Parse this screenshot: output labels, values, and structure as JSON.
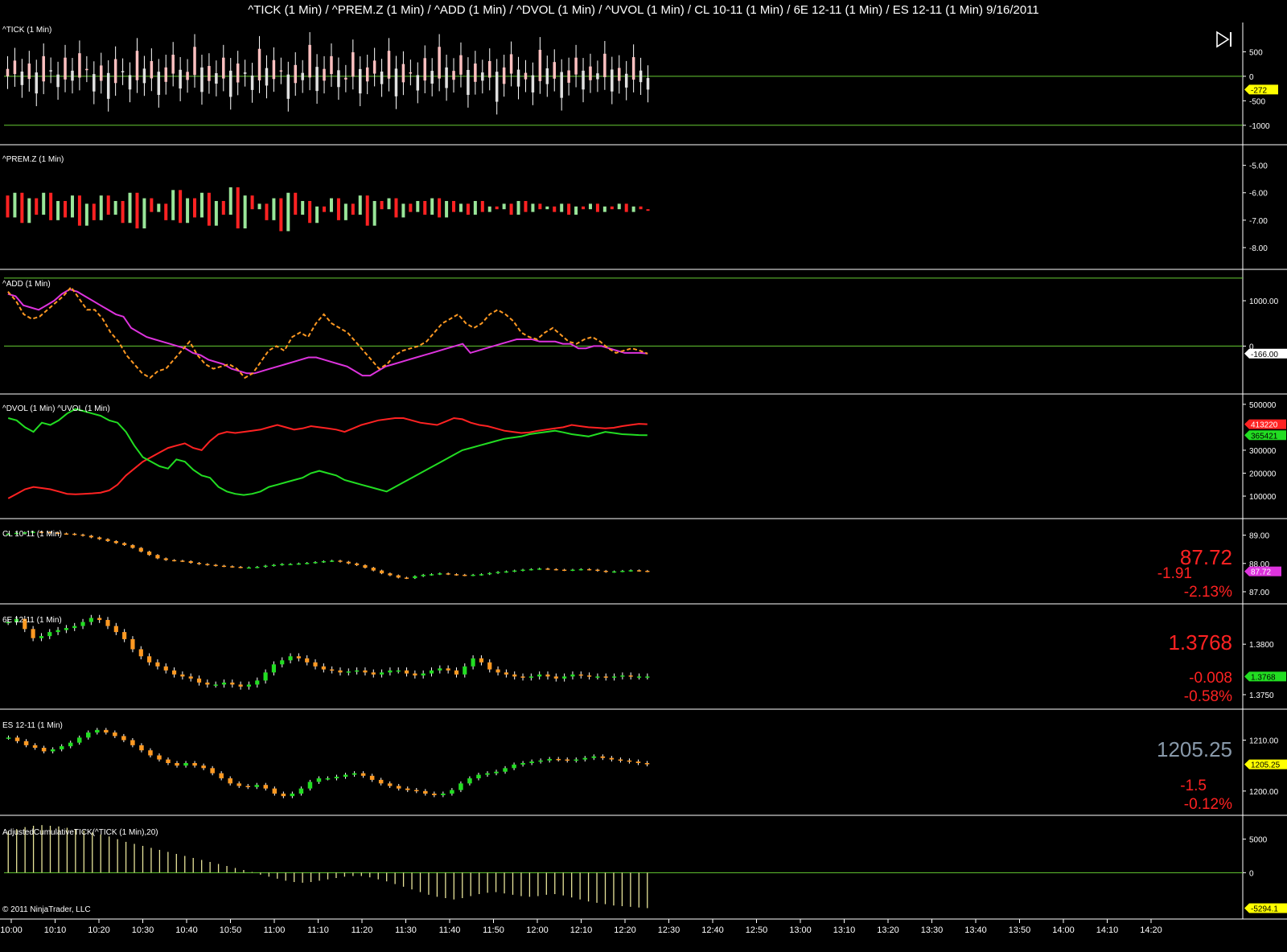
{
  "window": {
    "title": "^TICK (1 Min) / ^PREM.Z (1 Min) / ^ADD (1 Min) / ^DVOL (1 Min) / ^UVOL (1 Min) / CL 10-11 (1 Min) / 6E 12-11 (1 Min) / ES 12-11 (1 Min)  9/16/2011",
    "copyright": "© 2011 NinjaTrader, LLC",
    "play_icon": "play-to-end-icon"
  },
  "colors": {
    "background": "#000000",
    "grid_line": "#66cc33",
    "up_light": "#ffc0c0",
    "down_bar": "#e0e0e0",
    "red": "#ff2222",
    "green": "#22dd22",
    "light_green": "#99e699",
    "magenta": "#dd33dd",
    "orange": "#ff9922",
    "yellow_tag": "#ffff00",
    "gray_price": "#8899aa"
  },
  "time_axis": {
    "labels": [
      "10:00",
      "10:10",
      "10:20",
      "10:30",
      "10:40",
      "10:50",
      "11:00",
      "11:10",
      "11:20",
      "11:30",
      "11:40",
      "11:50",
      "12:00",
      "12:10",
      "12:20",
      "12:30",
      "12:40",
      "12:50",
      "13:00",
      "13:10",
      "13:20",
      "13:30",
      "13:40",
      "13:50",
      "14:00",
      "14:10",
      "14:20"
    ]
  },
  "chart_data": [
    {
      "panel": "tick",
      "type": "candlestick",
      "label": "^TICK (1 Min)",
      "y_ticks": [
        "500",
        "0",
        "-500",
        "-1000"
      ],
      "ylim": [
        -1200,
        900
      ],
      "hlines": [
        0,
        -1000
      ],
      "last_value": "-272",
      "close_series": [
        150,
        320,
        -180,
        260,
        -350,
        410,
        120,
        -220,
        380,
        -90,
        470,
        150,
        -310,
        220,
        -460,
        350,
        80,
        -270,
        520,
        -140,
        310,
        -380,
        180,
        440,
        -250,
        90,
        600,
        -320,
        210,
        -150,
        380,
        -420,
        260,
        50,
        -280,
        560,
        -190,
        330,
        120,
        -460,
        230,
        -80,
        640,
        -300,
        150,
        410,
        -220,
        -30,
        490,
        -350,
        180,
        320,
        -160,
        520,
        -410,
        250,
        80,
        -290,
        370,
        -150,
        600,
        -240,
        110,
        430,
        -380,
        260,
        -90,
        310,
        -520,
        180,
        450,
        -210,
        70,
        -330,
        540,
        -160,
        290,
        -440,
        120,
        380,
        -270,
        200,
        -60,
        460,
        -310,
        170,
        -230,
        390,
        -120,
        -272
      ]
    },
    {
      "panel": "premz",
      "type": "bar",
      "label": "^PREM.Z (1 Min)",
      "y_ticks": [
        "-5.00",
        "-6.00",
        "-7.00",
        "-8.00"
      ],
      "ylim": [
        -8.5,
        -4.6
      ],
      "open_series_note": "bars span open to close; red = down, light green = up",
      "opens": [
        -6.1,
        -6.9,
        -6.0,
        -7.1,
        -6.2,
        -6.8,
        -6.0,
        -7.0,
        -6.3,
        -6.9,
        -6.1,
        -7.2,
        -6.4,
        -7.0,
        -6.1,
        -6.8,
        -6.3,
        -7.1,
        -6.0,
        -7.3,
        -6.2,
        -6.7,
        -6.4,
        -7.0,
        -5.9,
        -7.1,
        -6.2,
        -6.9,
        -6.0,
        -7.2,
        -6.3,
        -6.8,
        -5.8,
        -7.3,
        -6.1,
        -6.6,
        -6.4,
        -7.0,
        -6.2,
        -7.4,
        -6.0,
        -6.8,
        -6.3,
        -7.1,
        -6.5,
        -6.7,
        -6.2,
        -7.0,
        -6.4,
        -6.8,
        -6.1,
        -7.2,
        -6.3,
        -6.6,
        -6.2,
        -6.9,
        -6.4,
        -6.7,
        -6.3,
        -6.8,
        -6.2,
        -6.9,
        -6.3,
        -6.7,
        -6.4,
        -6.8,
        -6.3,
        -6.7,
        -6.5,
        -6.6,
        -6.4,
        -6.8,
        -6.3,
        -6.7,
        -6.4,
        -6.6,
        -6.5,
        -6.7,
        -6.4,
        -6.8,
        -6.5,
        -6.6,
        -6.4,
        -6.7,
        -6.5,
        -6.6,
        -6.4,
        -6.7,
        -6.5,
        -6.6
      ],
      "closes": [
        -6.9,
        -6.0,
        -7.1,
        -6.2,
        -6.8,
        -6.0,
        -7.0,
        -6.3,
        -6.9,
        -6.1,
        -7.2,
        -6.4,
        -7.0,
        -6.1,
        -6.8,
        -6.3,
        -7.1,
        -6.0,
        -7.3,
        -6.2,
        -6.7,
        -6.4,
        -7.0,
        -5.9,
        -7.1,
        -6.2,
        -6.9,
        -6.0,
        -7.2,
        -6.3,
        -6.8,
        -5.8,
        -7.3,
        -6.1,
        -6.6,
        -6.4,
        -7.0,
        -6.2,
        -7.4,
        -6.0,
        -6.8,
        -6.3,
        -7.1,
        -6.5,
        -6.7,
        -6.2,
        -7.0,
        -6.4,
        -6.8,
        -6.1,
        -7.2,
        -6.3,
        -6.6,
        -6.2,
        -6.9,
        -6.4,
        -6.7,
        -6.3,
        -6.8,
        -6.2,
        -6.9,
        -6.3,
        -6.7,
        -6.4,
        -6.8,
        -6.3,
        -6.7,
        -6.5,
        -6.6,
        -6.4,
        -6.8,
        -6.3,
        -6.7,
        -6.4,
        -6.6,
        -6.5,
        -6.7,
        -6.4,
        -6.8,
        -6.5,
        -6.6,
        -6.4,
        -6.7,
        -6.5,
        -6.6,
        -6.4,
        -6.7,
        -6.5,
        -6.6,
        -6.6
      ]
    },
    {
      "panel": "add",
      "type": "line",
      "label": "^ADD (1 Min)",
      "y_ticks": [
        "1000.00",
        "0"
      ],
      "ylim": [
        -950,
        1550
      ],
      "hlines": [
        0,
        1500
      ],
      "last_value": "-166.00",
      "series": [
        {
          "color": "#dd33dd",
          "style": "solid",
          "values": [
            1150,
            1100,
            900,
            850,
            800,
            900,
            1000,
            1150,
            1250,
            1200,
            1100,
            1000,
            900,
            800,
            700,
            650,
            400,
            300,
            200,
            150,
            100,
            50,
            0,
            -50,
            -150,
            -200,
            -300,
            -350,
            -400,
            -500,
            -550,
            -600,
            -600,
            -550,
            -500,
            -450,
            -400,
            -350,
            -300,
            -250,
            -250,
            -300,
            -350,
            -400,
            -450,
            -550,
            -650,
            -650,
            -550,
            -450,
            -400,
            -350,
            -300,
            -250,
            -200,
            -150,
            -100,
            -50,
            0,
            50,
            -150,
            -100,
            -50,
            0,
            50,
            100,
            150,
            150,
            150,
            100,
            100,
            100,
            50,
            50,
            -50,
            -50,
            0,
            0,
            -50,
            -100,
            -150,
            -150,
            -150,
            -166
          ]
        },
        {
          "color": "#ff9922",
          "style": "dashed",
          "values": [
            1200,
            1000,
            700,
            600,
            650,
            800,
            950,
            1100,
            1300,
            1050,
            800,
            800,
            600,
            300,
            100,
            -200,
            -400,
            -600,
            -700,
            -550,
            -500,
            -300,
            -100,
            100,
            -200,
            -400,
            -500,
            -450,
            -400,
            -500,
            -700,
            -600,
            -350,
            -100,
            0,
            -100,
            200,
            300,
            200,
            500,
            700,
            500,
            400,
            300,
            100,
            -100,
            -300,
            -500,
            -400,
            -200,
            -100,
            -50,
            0,
            100,
            300,
            500,
            600,
            700,
            500,
            400,
            500,
            700,
            800,
            700,
            550,
            300,
            200,
            150,
            300,
            400,
            250,
            100,
            50,
            150,
            200,
            100,
            -50,
            -150,
            -100,
            -50,
            -100,
            -166
          ]
        }
      ]
    },
    {
      "panel": "dvol_uvol",
      "type": "line",
      "label": "^DVOL (1 Min)  ^UVOL (1 Min)",
      "y_ticks": [
        "500000",
        "300000",
        "200000",
        "100000"
      ],
      "ylim": [
        30000,
        510000
      ],
      "last_values": {
        "red": "413220",
        "green": "365421"
      },
      "series": [
        {
          "color": "#ff2222",
          "values": [
            90000,
            110000,
            130000,
            140000,
            135000,
            130000,
            120000,
            110000,
            108000,
            110000,
            112000,
            115000,
            125000,
            150000,
            190000,
            220000,
            250000,
            270000,
            290000,
            310000,
            320000,
            330000,
            310000,
            300000,
            340000,
            370000,
            380000,
            375000,
            380000,
            385000,
            390000,
            400000,
            410000,
            400000,
            390000,
            395000,
            405000,
            400000,
            395000,
            390000,
            380000,
            395000,
            410000,
            420000,
            430000,
            435000,
            440000,
            440000,
            430000,
            420000,
            415000,
            410000,
            425000,
            440000,
            435000,
            420000,
            410000,
            405000,
            395000,
            385000,
            380000,
            375000,
            378000,
            385000,
            390000,
            395000,
            400000,
            410000,
            405000,
            400000,
            398000,
            395000,
            398000,
            405000,
            410000,
            415000,
            413220
          ]
        },
        {
          "color": "#22dd22",
          "values": [
            440000,
            430000,
            400000,
            380000,
            420000,
            410000,
            430000,
            460000,
            480000,
            470000,
            460000,
            450000,
            430000,
            420000,
            380000,
            320000,
            270000,
            250000,
            230000,
            220000,
            260000,
            250000,
            215000,
            190000,
            180000,
            140000,
            120000,
            110000,
            105000,
            110000,
            120000,
            140000,
            150000,
            160000,
            170000,
            180000,
            200000,
            210000,
            200000,
            190000,
            170000,
            160000,
            150000,
            140000,
            130000,
            120000,
            140000,
            160000,
            180000,
            200000,
            220000,
            240000,
            260000,
            280000,
            300000,
            310000,
            320000,
            330000,
            340000,
            350000,
            355000,
            360000,
            370000,
            375000,
            380000,
            385000,
            378000,
            370000,
            365000,
            360000,
            370000,
            380000,
            375000,
            370000,
            368000,
            366000,
            365421
          ]
        }
      ]
    },
    {
      "panel": "cl",
      "type": "candlestick",
      "label": "CL 10-11 (1 Min)",
      "y_ticks": [
        "89.00",
        "88.00",
        "87.00"
      ],
      "ylim": [
        86.8,
        89.3
      ],
      "last_value": "87.72",
      "big_price": "87.72",
      "change": "-1.91",
      "change_pct": "-2.13%",
      "close_series": [
        89.05,
        89.08,
        89.1,
        89.12,
        89.11,
        89.09,
        89.06,
        89.05,
        89.02,
        88.98,
        88.92,
        88.86,
        88.79,
        88.72,
        88.65,
        88.55,
        88.42,
        88.3,
        88.18,
        88.12,
        88.1,
        88.08,
        88.02,
        87.98,
        87.95,
        87.92,
        87.9,
        87.88,
        87.86,
        87.86,
        87.88,
        87.92,
        87.95,
        87.98,
        87.98,
        88.0,
        88.02,
        88.05,
        88.08,
        88.1,
        88.06,
        88.0,
        87.94,
        87.85,
        87.75,
        87.65,
        87.58,
        87.5,
        87.48,
        87.55,
        87.6,
        87.62,
        87.65,
        87.62,
        87.6,
        87.58,
        87.6,
        87.62,
        87.66,
        87.7,
        87.72,
        87.75,
        87.78,
        87.8,
        87.82,
        87.8,
        87.78,
        87.76,
        87.78,
        87.8,
        87.78,
        87.74,
        87.7,
        87.72,
        87.74,
        87.76,
        87.74,
        87.72
      ]
    },
    {
      "panel": "6e",
      "type": "candlestick",
      "label": "6E 12-11 (1 Min)",
      "y_ticks": [
        "1.3800",
        "1.3750"
      ],
      "ylim": [
        1.3742,
        1.3832
      ],
      "last_value": "1.3768",
      "big_price": "1.3768",
      "change": "-0.008",
      "change_pct": "-0.58%",
      "close_series": [
        1.3822,
        1.3825,
        1.3815,
        1.3806,
        1.3808,
        1.3812,
        1.3814,
        1.3816,
        1.3818,
        1.3822,
        1.3826,
        1.3824,
        1.3818,
        1.3812,
        1.3805,
        1.3795,
        1.3788,
        1.3782,
        1.3778,
        1.3774,
        1.377,
        1.3768,
        1.3766,
        1.3762,
        1.376,
        1.376,
        1.3762,
        1.376,
        1.3758,
        1.376,
        1.3764,
        1.3772,
        1.378,
        1.3784,
        1.3788,
        1.3786,
        1.3782,
        1.3778,
        1.3775,
        1.3774,
        1.3772,
        1.3773,
        1.3774,
        1.3772,
        1.377,
        1.3772,
        1.3774,
        1.3774,
        1.3771,
        1.3769,
        1.3771,
        1.3774,
        1.3776,
        1.3774,
        1.377,
        1.3778,
        1.3786,
        1.3782,
        1.3775,
        1.3772,
        1.377,
        1.3768,
        1.3767,
        1.3768,
        1.377,
        1.3768,
        1.3766,
        1.3768,
        1.377,
        1.3769,
        1.3768,
        1.3768,
        1.3767,
        1.3768,
        1.3769,
        1.3768,
        1.3768,
        1.3768
      ]
    },
    {
      "panel": "es",
      "type": "candlestick",
      "label": "ES 12-11 (1 Min)",
      "y_ticks": [
        "1210.00",
        "1200.00"
      ],
      "ylim": [
        1196.5,
        1214.5
      ],
      "last_value": "1205.25",
      "big_price": "1205.25",
      "change": "-1.5",
      "change_pct": "-0.12%",
      "close_series": [
        1210.5,
        1209.8,
        1209.0,
        1208.5,
        1207.8,
        1208.2,
        1208.8,
        1209.5,
        1210.5,
        1211.5,
        1212.0,
        1211.5,
        1210.8,
        1210.0,
        1209.0,
        1208.0,
        1207.0,
        1206.2,
        1205.5,
        1205.0,
        1205.5,
        1205.0,
        1204.5,
        1203.5,
        1202.5,
        1201.5,
        1201.0,
        1200.8,
        1201.2,
        1200.5,
        1199.5,
        1199.0,
        1199.5,
        1200.5,
        1201.8,
        1202.5,
        1202.5,
        1202.8,
        1203.2,
        1203.5,
        1203.0,
        1202.2,
        1201.5,
        1201.0,
        1200.5,
        1200.2,
        1200.0,
        1199.5,
        1199.2,
        1199.5,
        1200.2,
        1201.5,
        1202.5,
        1203.2,
        1203.5,
        1203.8,
        1204.5,
        1205.2,
        1205.5,
        1205.8,
        1206.0,
        1206.3,
        1206.2,
        1206.0,
        1206.2,
        1206.5,
        1206.8,
        1206.5,
        1206.2,
        1206.0,
        1205.8,
        1205.5,
        1205.25
      ]
    },
    {
      "panel": "cumtick",
      "type": "bar",
      "label": "AdjustedCumulativeTICK(^TICK (1 Min),20)",
      "y_ticks": [
        "5000",
        "0"
      ],
      "ylim": [
        -6200,
        7600
      ],
      "hlines": [
        0
      ],
      "last_value": "-5294.1",
      "values": [
        6200,
        6500,
        6800,
        7000,
        7100,
        7000,
        6900,
        6700,
        6500,
        6300,
        6000,
        5700,
        5400,
        5000,
        4600,
        4300,
        4000,
        3700,
        3400,
        3100,
        2800,
        2500,
        2200,
        1900,
        1600,
        1300,
        1000,
        700,
        400,
        100,
        -300,
        -600,
        -900,
        -1200,
        -1400,
        -1500,
        -1400,
        -1200,
        -1000,
        -800,
        -600,
        -500,
        -500,
        -700,
        -1000,
        -1300,
        -1700,
        -2100,
        -2500,
        -2900,
        -3300,
        -3600,
        -3800,
        -4000,
        -3800,
        -3500,
        -3200,
        -3000,
        -2900,
        -3100,
        -3300,
        -3500,
        -3600,
        -3500,
        -3300,
        -3200,
        -3400,
        -3700,
        -4000,
        -4300,
        -4500,
        -4700,
        -4900,
        -5000,
        -5100,
        -5200,
        -5294.1
      ]
    }
  ]
}
